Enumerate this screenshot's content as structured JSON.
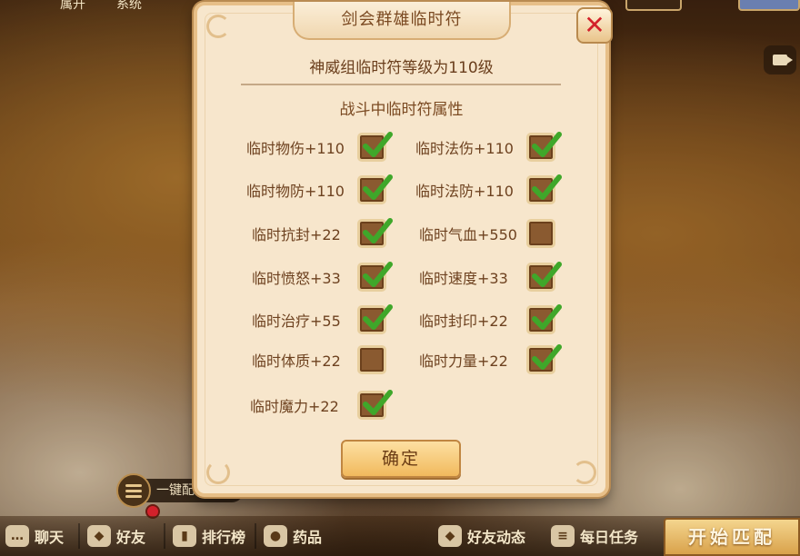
{
  "top": {
    "hint_left": "属开",
    "hint_right": "系统"
  },
  "dialog": {
    "title": "剑会群雄临时符",
    "close_icon": "✕",
    "subtitle": "神威组临时符等级为110级",
    "section_title": "战斗中临时符属性",
    "confirm_label": "确定",
    "attributes_left": [
      {
        "label": "临时物伤+110",
        "checked": true
      },
      {
        "label": "临时物防+110",
        "checked": true
      },
      {
        "label": "临时抗封+22",
        "checked": true
      },
      {
        "label": "临时愤怒+33",
        "checked": true
      },
      {
        "label": "临时治疗+55",
        "checked": true
      },
      {
        "label": "临时体质+22",
        "checked": false
      },
      {
        "label": "临时魔力+22",
        "checked": true
      }
    ],
    "attributes_right": [
      {
        "label": "临时法伤+110",
        "checked": true
      },
      {
        "label": "临时法防+110",
        "checked": true
      },
      {
        "label": "临时气血+550",
        "checked": false
      },
      {
        "label": "临时速度+33",
        "checked": true
      },
      {
        "label": "临时封印+22",
        "checked": true
      },
      {
        "label": "临时力量+22",
        "checked": true
      }
    ]
  },
  "quick_config": {
    "label": "一键配置"
  },
  "bottom_bar": {
    "chat": "聊天",
    "friends": "好友",
    "ranking": "排行榜",
    "medicine": "药品",
    "friend_updates": "好友动态",
    "daily_tasks": "每日任务",
    "start_match": "开始匹配"
  },
  "colors": {
    "check_green": "#3fa72a",
    "close_red": "#d3212b",
    "accent_gold": "#f1b95d"
  }
}
